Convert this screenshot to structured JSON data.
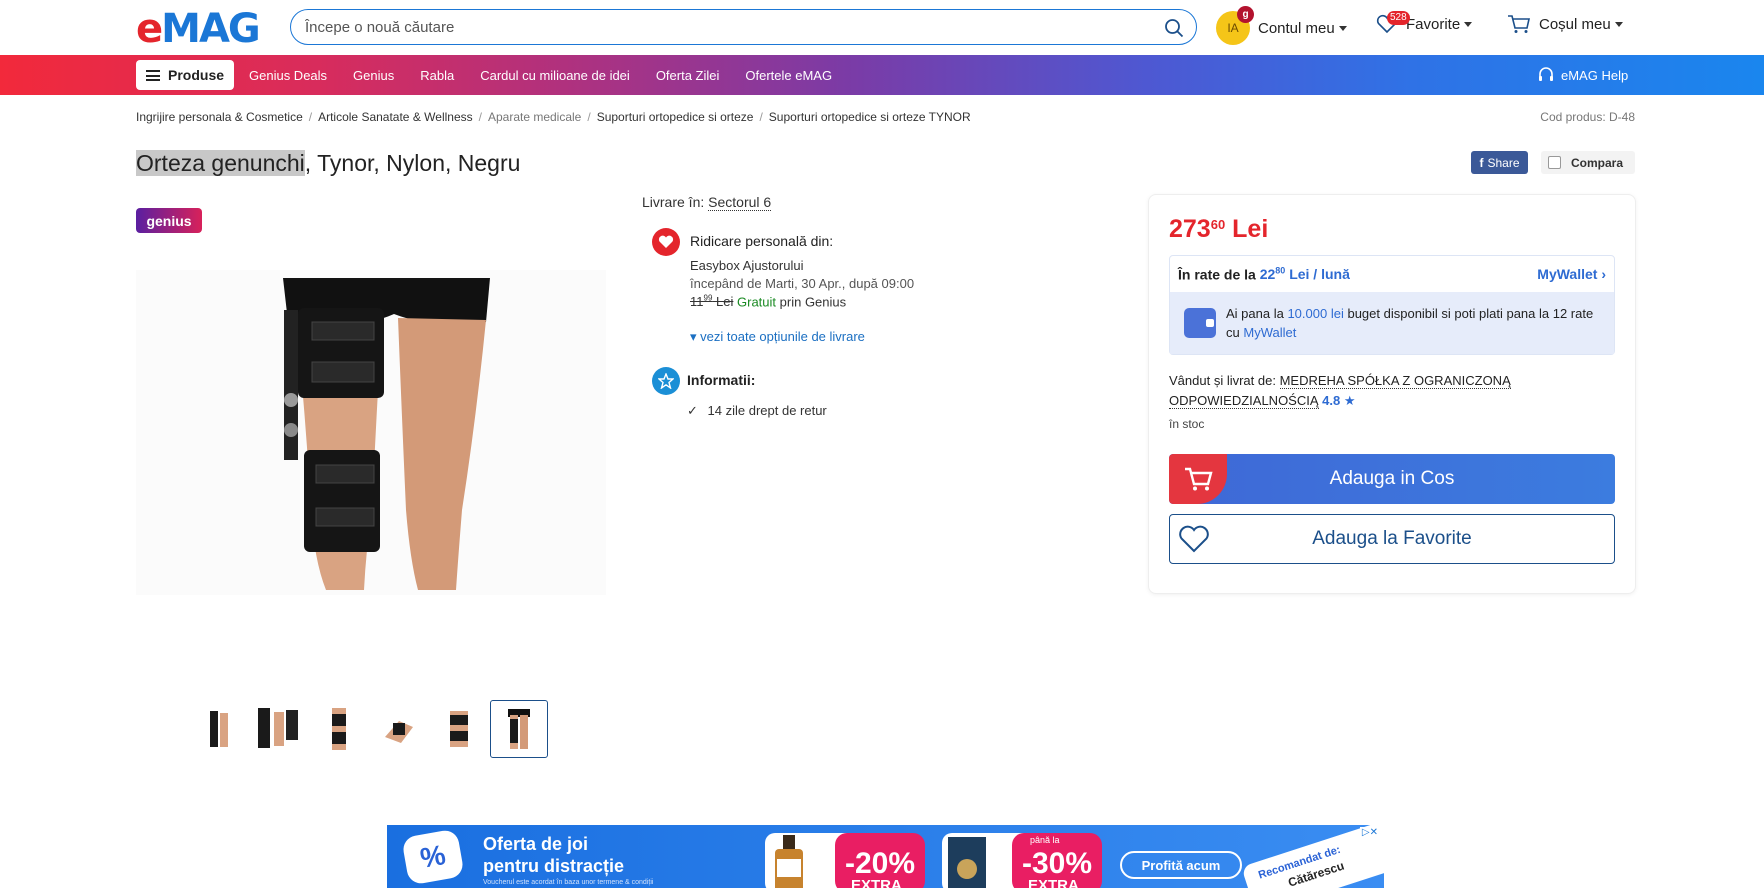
{
  "header": {
    "logo": {
      "e": "e",
      "mag": "MAG"
    },
    "search_placeholder": "Începe o nouă căutare",
    "account": {
      "initials": "IA",
      "badge": "g",
      "label": "Contul meu"
    },
    "favorites": {
      "label": "Favorite",
      "count": "528"
    },
    "cart": {
      "label": "Coșul meu"
    }
  },
  "nav": {
    "produse": "Produse",
    "links": [
      "Genius Deals",
      "Genius",
      "Rabla",
      "Cardul cu milioane de idei",
      "Oferta Zilei",
      "Ofertele eMAG"
    ],
    "help": "eMAG Help"
  },
  "breadcrumb": [
    "Ingrijire personala & Cosmetice",
    "Articole Sanatate & Wellness",
    "Aparate medicale",
    "Suporturi ortopedice si orteze",
    "Suporturi ortopedice si orteze TYNOR"
  ],
  "product_code": "Cod produs: D-48",
  "product": {
    "title_highlight": "Orteza genunchi",
    "title_rest": ", Tynor, Nylon, Negru",
    "genius_badge": "genius",
    "share": "Share",
    "compare": "Compara"
  },
  "delivery": {
    "label": "Livrare în:",
    "location": "Sectorul 6",
    "pickup_title": "Ridicare personală din:",
    "pickup_place": "Easybox Ajustorului",
    "pickup_time": "începând de Marti, 30 Apr., după 09:00",
    "old_price_int": "11",
    "old_price_dec": "99",
    "old_price_cur": "Lei",
    "free": "Gratuit",
    "via": "prin Genius",
    "more_options": "vezi toate opțiunile de livrare",
    "info_title": "Informatii:",
    "return_policy": "14 zile drept de retur"
  },
  "buybox": {
    "price_int": "273",
    "price_dec": "60",
    "currency": "Lei",
    "rate_label": "În rate de la",
    "rate_int": "22",
    "rate_dec": "80",
    "rate_suffix": "Lei / lună",
    "mywallet": "MyWallet",
    "wallet_text_1": "Ai pana la",
    "wallet_amount": "10.000 lei",
    "wallet_text_2": "buget disponibil si poti plati pana la 12 rate cu",
    "wallet_link": "MyWallet",
    "seller_label": "Vândut și livrat de:",
    "seller_name": "MEDREHA SPÓŁKA Z OGRANICZONĄ ODPOWIEDZIALNOŚCIĄ",
    "seller_rating": "4.8",
    "stock": "în stoc",
    "add_to_cart": "Adauga in Cos",
    "add_to_fav": "Adauga la Favorite"
  },
  "ad": {
    "title_1": "Oferta de joi",
    "title_2": "pentru distracție",
    "fine_print": "Voucherul este acordat în baza unor termene & condiții",
    "disc1_pre": "",
    "disc1": "-20%",
    "disc1_extra": "EXTRA",
    "disc2_pre": "până la",
    "disc2": "-30%",
    "disc2_extra": "EXTRA",
    "cta": "Profită acum",
    "tag": "Recomandat de:",
    "tag_name": "Cătărescu",
    "badge": "%"
  },
  "colors": {
    "brand_red": "#e4252c",
    "brand_blue": "#1b77d6",
    "price_red": "#e4252c"
  }
}
